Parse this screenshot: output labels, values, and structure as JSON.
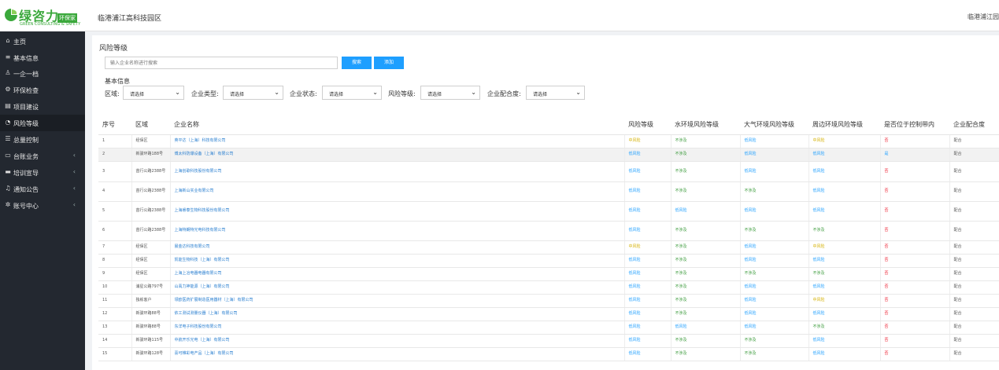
{
  "brand": {
    "name": "绿咨力",
    "badge": "环保家",
    "sub": "GREEN CONSULTING & SAFETY"
  },
  "header": {
    "park": "临港浦江高科技园区",
    "right": "临港浦江园"
  },
  "sidebar": {
    "items": [
      {
        "label": "主页",
        "icon": "home-icon",
        "glyph": "⌂",
        "chevron": false
      },
      {
        "label": "基本信息",
        "icon": "list-icon",
        "glyph": "≡",
        "chevron": false
      },
      {
        "label": "一企一档",
        "icon": "user-icon",
        "glyph": "♙",
        "chevron": false
      },
      {
        "label": "环保检查",
        "icon": "gear-icon",
        "glyph": "⚙",
        "chevron": false
      },
      {
        "label": "项目建设",
        "icon": "building-icon",
        "glyph": "▤",
        "chevron": false
      },
      {
        "label": "风险等级",
        "icon": "gauge-icon",
        "glyph": "◔",
        "chevron": false,
        "active": true
      },
      {
        "label": "总量控制",
        "icon": "database-icon",
        "glyph": "☰",
        "chevron": false
      },
      {
        "label": "台账业务",
        "icon": "laptop-icon",
        "glyph": "▭",
        "chevron": true
      },
      {
        "label": "培训宣导",
        "icon": "keyboard-icon",
        "glyph": "▬",
        "chevron": true
      },
      {
        "label": "通知公告",
        "icon": "bell-icon",
        "glyph": "♫",
        "chevron": true
      },
      {
        "label": "账号中心",
        "icon": "settings-icon",
        "glyph": "✲",
        "chevron": true
      }
    ]
  },
  "page": {
    "title": "风险等级"
  },
  "search": {
    "placeholder": "输入企业名称进行搜索",
    "search_label": "搜索",
    "add_label": "添加"
  },
  "filters": {
    "section_label": "基本信息",
    "items": [
      {
        "label": "区域:",
        "value": "请选择"
      },
      {
        "label": "企业类型:",
        "value": "请选择"
      },
      {
        "label": "企业状态:",
        "value": "请选择"
      },
      {
        "label": "风险等级:",
        "value": "请选择"
      },
      {
        "label": "企业配合度:",
        "value": "请选择"
      }
    ]
  },
  "table": {
    "columns": [
      "序号",
      "区域",
      "企业名称",
      "风险等级",
      "水环境风险等级",
      "大气环境风险等级",
      "周边环境风险等级",
      "是否位于控制带内",
      "企业配合度"
    ],
    "rows": [
      {
        "no": "1",
        "area": "经保区",
        "name": "英平达（上海）科技有限公司",
        "risk": [
          "中风险",
          "不涉及",
          "低风险",
          "中风险"
        ],
        "zone": "否",
        "coop": "配合"
      },
      {
        "no": "2",
        "area": "新骏环路188号",
        "name": "博太科防爆设备（上海）有限公司",
        "risk": [
          "低风险",
          "不涉及",
          "低风险",
          "低风险"
        ],
        "zone": "是",
        "coop": "配合"
      },
      {
        "no": "3",
        "area": "苗行公路2388号",
        "name": "上海创歌科技股份有限公司",
        "risk": [
          "低风险",
          "不涉及",
          "低风险",
          "低风险"
        ],
        "zone": "否",
        "coop": "配合"
      },
      {
        "no": "4",
        "area": "苗行公路2388号",
        "name": "上海新山实业有限公司",
        "risk": [
          "低风险",
          "不涉及",
          "不涉及",
          "低风险"
        ],
        "zone": "否",
        "coop": "配合"
      },
      {
        "no": "5",
        "area": "苗行公路2388号",
        "name": "上海睿泰生物科技股份有限公司",
        "risk": [
          "低风险",
          "低风险",
          "低风险",
          "低风险"
        ],
        "zone": "否",
        "coop": "配合"
      },
      {
        "no": "6",
        "area": "苗行公路2388号",
        "name": "上海特朗特光电科技有限公司",
        "risk": [
          "低风险",
          "不涉及",
          "不涉及",
          "不涉及"
        ],
        "zone": "否",
        "coop": "配合"
      },
      {
        "no": "7",
        "area": "经保区",
        "name": "晨金达科技有限公司",
        "risk": [
          "中风险",
          "不涉及",
          "低风险",
          "中风险"
        ],
        "zone": "否",
        "coop": "配合"
      },
      {
        "no": "8",
        "area": "经保区",
        "name": "凯能生物科技（上海）有限公司",
        "risk": [
          "低风险",
          "不涉及",
          "低风险",
          "低风险"
        ],
        "zone": "否",
        "coop": "配合"
      },
      {
        "no": "9",
        "area": "经保区",
        "name": "上海上冶电器电器有限公司",
        "risk": [
          "低风险",
          "不涉及",
          "不涉及",
          "不涉及"
        ],
        "zone": "否",
        "coop": "配合"
      },
      {
        "no": "10",
        "area": "浦星公路797号",
        "name": "山禹力神能源（上海）有限公司",
        "risk": [
          "低风险",
          "不涉及",
          "低风险",
          "低风险"
        ],
        "zone": "否",
        "coop": "配合"
      },
      {
        "no": "11",
        "area": "独栋客户",
        "name": "领欧医药扩展制造医用器材（上海）有限公司",
        "risk": [
          "低风险",
          "不涉及",
          "低风险",
          "中风险"
        ],
        "zone": "否",
        "coop": "配合"
      },
      {
        "no": "12",
        "area": "新骏环路88号",
        "name": "依工测试测量仪器（上海）有限公司",
        "risk": [
          "低风险",
          "不涉及",
          "低风险",
          "低风险"
        ],
        "zone": "否",
        "coop": "配合"
      },
      {
        "no": "13",
        "area": "新骏环路88号",
        "name": "东洋电子科技股份有限公司",
        "risk": [
          "低风险",
          "低风险",
          "低风险",
          "不涉及"
        ],
        "zone": "否",
        "coop": "配合"
      },
      {
        "no": "14",
        "area": "新骏环路115号",
        "name": "中航开乐光电（上海）有限公司",
        "risk": [
          "低风险",
          "不涉及",
          "不涉及",
          "低风险"
        ],
        "zone": "否",
        "coop": "配合"
      },
      {
        "no": "15",
        "area": "新骏环路128号",
        "name": "喜可帷彩电产品（上海）有限公司",
        "risk": [
          "低风险",
          "不涉及",
          "不涉及",
          "低风险"
        ],
        "zone": "否",
        "coop": "配合"
      }
    ]
  },
  "colors": {
    "sidebar_bg": "#232830",
    "accent": "#1e9fff",
    "brand_green": "#3aa83b",
    "risk_medium": "#d4b000",
    "risk_low": "#1e9fff",
    "not_applicable": "#3a9a3a",
    "no_red": "#e23"
  }
}
